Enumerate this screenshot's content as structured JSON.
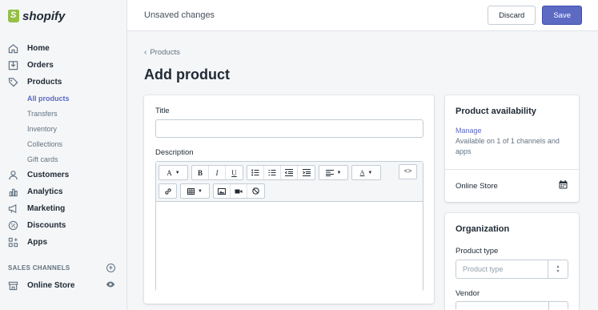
{
  "brand": {
    "logo_text": "shopify"
  },
  "sidebar": {
    "items": [
      {
        "label": "Home",
        "icon": "home-icon"
      },
      {
        "label": "Orders",
        "icon": "orders-icon"
      },
      {
        "label": "Products",
        "icon": "tag-icon"
      }
    ],
    "product_subitems": [
      "All products",
      "Transfers",
      "Inventory",
      "Collections",
      "Gift cards"
    ],
    "items_after": [
      {
        "label": "Customers",
        "icon": "person-icon"
      },
      {
        "label": "Analytics",
        "icon": "bar-chart-icon"
      },
      {
        "label": "Marketing",
        "icon": "megaphone-icon"
      },
      {
        "label": "Discounts",
        "icon": "discount-icon"
      },
      {
        "label": "Apps",
        "icon": "apps-icon"
      }
    ],
    "sales_channels_heading": "SALES CHANNELS",
    "online_store": "Online Store"
  },
  "topbar": {
    "status": "Unsaved changes",
    "discard_label": "Discard",
    "save_label": "Save"
  },
  "main": {
    "breadcrumb": "Products",
    "title": "Add product",
    "title_label": "Title",
    "title_value": "",
    "description_label": "Description",
    "editor_toolbar": {
      "font_button": "A",
      "bold": "B",
      "italic": "I",
      "underline": "U",
      "text_color": "A",
      "code": "<>"
    }
  },
  "availability": {
    "title": "Product availability",
    "manage": "Manage",
    "text": "Available on 1 of 1 channels and apps",
    "store": "Online Store"
  },
  "organization": {
    "title": "Organization",
    "product_type_label": "Product type",
    "product_type_placeholder": "Product type",
    "vendor_label": "Vendor"
  },
  "colors": {
    "accent": "#5c6ac4",
    "logo_green": "#95bf47"
  }
}
